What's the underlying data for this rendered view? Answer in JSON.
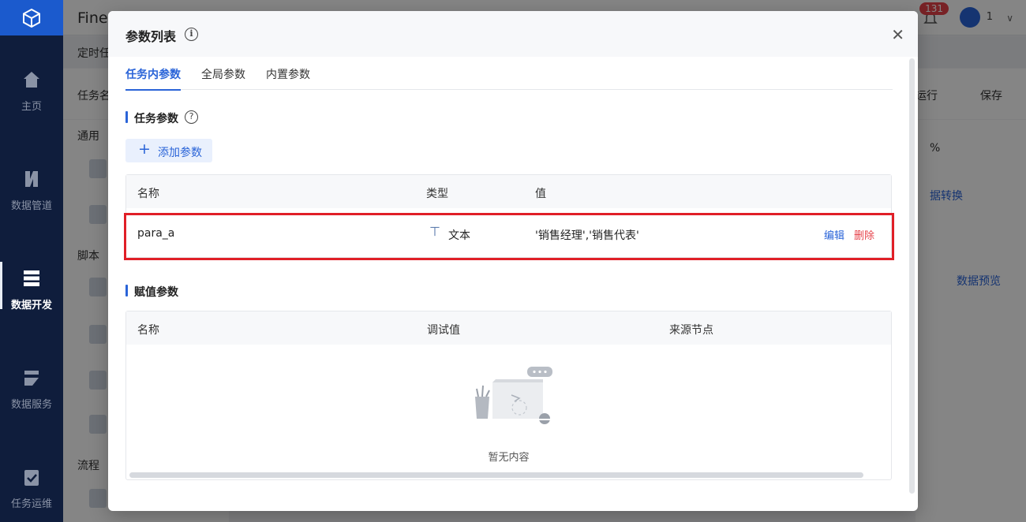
{
  "app": {
    "brand": "FineD",
    "notifications": "131",
    "user": "1",
    "sub_title": "定时任",
    "task_name_label": "任务名",
    "run_label": "运行",
    "save_label": "保存",
    "zoom_suffix": "%",
    "convert_label": "据转换",
    "preview_label": "数据预览"
  },
  "sidebar": {
    "items": [
      {
        "label": "主页"
      },
      {
        "label": "数据管道"
      },
      {
        "label": "数据开发"
      },
      {
        "label": "数据服务"
      },
      {
        "label": "任务运维"
      }
    ]
  },
  "node_panel": {
    "sections": [
      "通用",
      "脚本",
      "流程"
    ],
    "node_icons": [
      "SQL",
      "Shell",
      "BAT",
      "Python"
    ]
  },
  "modal": {
    "title": "参数列表",
    "tabs": [
      {
        "label": "任务内参数",
        "active": true
      },
      {
        "label": "全局参数",
        "active": false
      },
      {
        "label": "内置参数",
        "active": false
      }
    ],
    "task_params": {
      "section_title": "任务参数",
      "add_button": "添加参数",
      "columns": [
        "名称",
        "类型",
        "值"
      ],
      "rows": [
        {
          "name": "para_a",
          "type_icon": "text-type-icon",
          "type": "文本",
          "value": "'销售经理','销售代表'",
          "edit": "编辑",
          "delete": "删除"
        }
      ]
    },
    "assign_params": {
      "section_title": "赋值参数",
      "columns": [
        "名称",
        "调试值",
        "来源节点"
      ],
      "empty_text": "暂无内容"
    }
  },
  "colors": {
    "accent": "#2a64d8",
    "danger": "#e01f27",
    "nav_bg": "#0f1d3c"
  }
}
